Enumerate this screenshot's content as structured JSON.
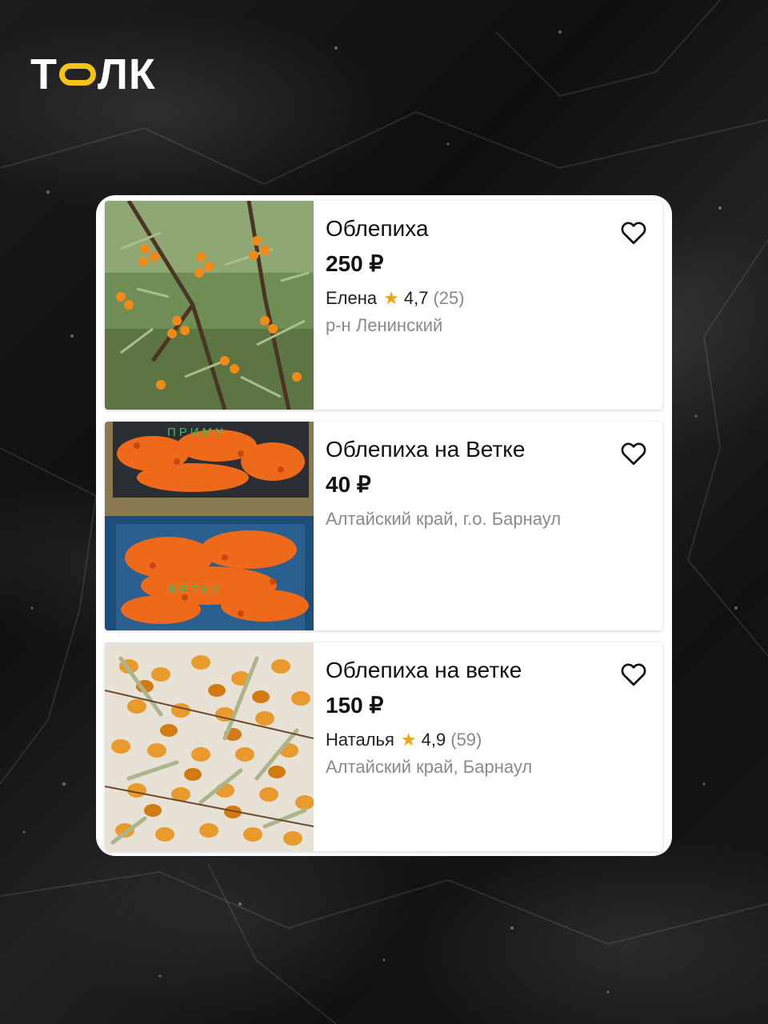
{
  "brand": {
    "letter_1": "Т",
    "letters_rest": "ЛК",
    "accent_color": "#f6c419"
  },
  "listings": [
    {
      "title": "Облепиха",
      "price": "250 ₽",
      "seller": "Елена",
      "rating": "4,7",
      "reviews": "(25)",
      "location": "р-н Ленинский",
      "image": "sea-buckthorn-bush-photo",
      "favorite_icon": "heart-outline-icon"
    },
    {
      "title": "Облепиха на Ветке",
      "price": "40 ₽",
      "location": "Алтайский край, г.о. Барнаул",
      "image": "sea-buckthorn-branches-in-crates-photo",
      "image_caption_top": "ПРИМУ",
      "image_caption_bottom": "ВЕТКУ",
      "favorite_icon": "heart-outline-icon"
    },
    {
      "title": "Облепиха на ветке",
      "price": "150 ₽",
      "seller": "Наталья",
      "rating": "4,9",
      "reviews": "(59)",
      "location": "Алтайский край, Барнаул",
      "image": "sea-buckthorn-berries-closeup-photo",
      "favorite_icon": "heart-outline-icon"
    }
  ],
  "colors": {
    "star": "#f6a10e",
    "price_text": "#111111",
    "secondary_text": "#8a8a8a"
  }
}
